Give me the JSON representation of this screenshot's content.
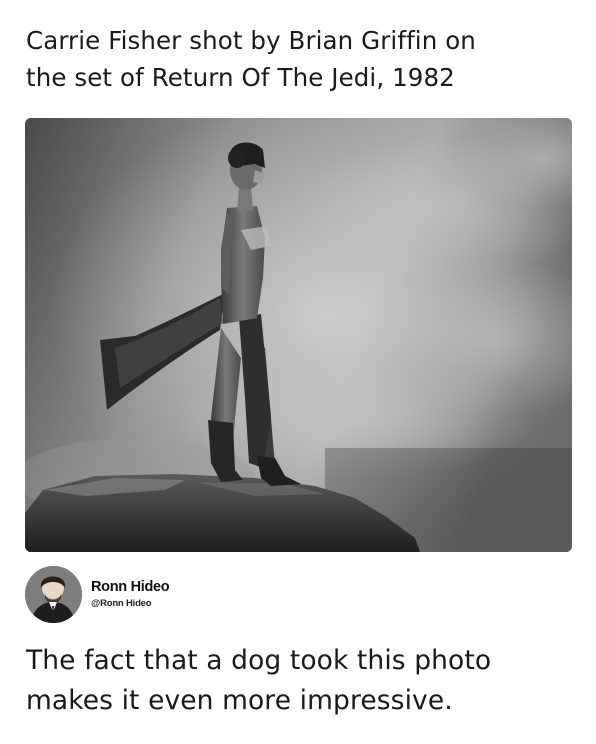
{
  "post": {
    "caption_line1": "Carrie Fisher shot by Brian Griffin on",
    "caption_line2": "the set of Return Of The Jedi, 1982"
  },
  "photo": {
    "style": "black-and-white",
    "subject": "figure standing on rock ledge with flowing cape against cloudy sky"
  },
  "author": {
    "name": "Ronn Hideo",
    "handle": "@Ronn Hideo",
    "avatar_icon": "user-avatar"
  },
  "comment": {
    "line1": "The fact that a dog took this photo",
    "line2": "makes it even more impressive."
  },
  "colors": {
    "background": "#ffffff",
    "text": "#1a1a1a"
  }
}
